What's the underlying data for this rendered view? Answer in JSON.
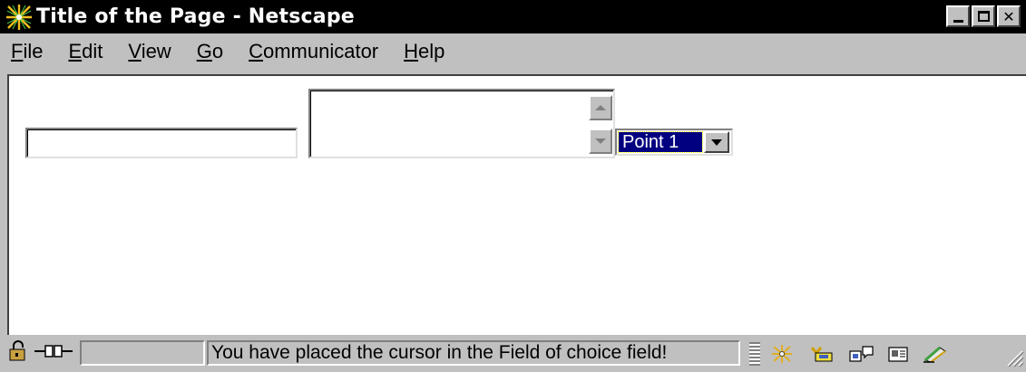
{
  "window": {
    "title": "Title of the Page - Netscape",
    "controls": {
      "minimize_icon": "minimize-icon",
      "maximize_icon": "maximize-icon",
      "close_label": "✕"
    }
  },
  "menu": {
    "items": [
      {
        "underline": "F",
        "rest": "ile"
      },
      {
        "underline": "E",
        "rest": "dit"
      },
      {
        "underline": "V",
        "rest": "iew"
      },
      {
        "underline": "G",
        "rest": "o"
      },
      {
        "underline": "C",
        "rest": "ommunicator"
      },
      {
        "underline": "H",
        "rest": "elp"
      }
    ]
  },
  "form": {
    "text_field": {
      "value": ""
    },
    "textarea": {
      "value": ""
    },
    "select": {
      "selected": "Point 1"
    }
  },
  "status": {
    "message": "You have placed the cursor in the Field of choice field!",
    "left_icons": [
      "security-lock-icon",
      "connection-plug-icon"
    ],
    "component_icons": [
      "navigator-icon",
      "mailbox-icon",
      "discussion-icon",
      "address-book-icon",
      "composer-icon"
    ]
  },
  "colors": {
    "titlebar": "#000000",
    "chrome": "#c0c0c0",
    "selection": "#000080"
  }
}
